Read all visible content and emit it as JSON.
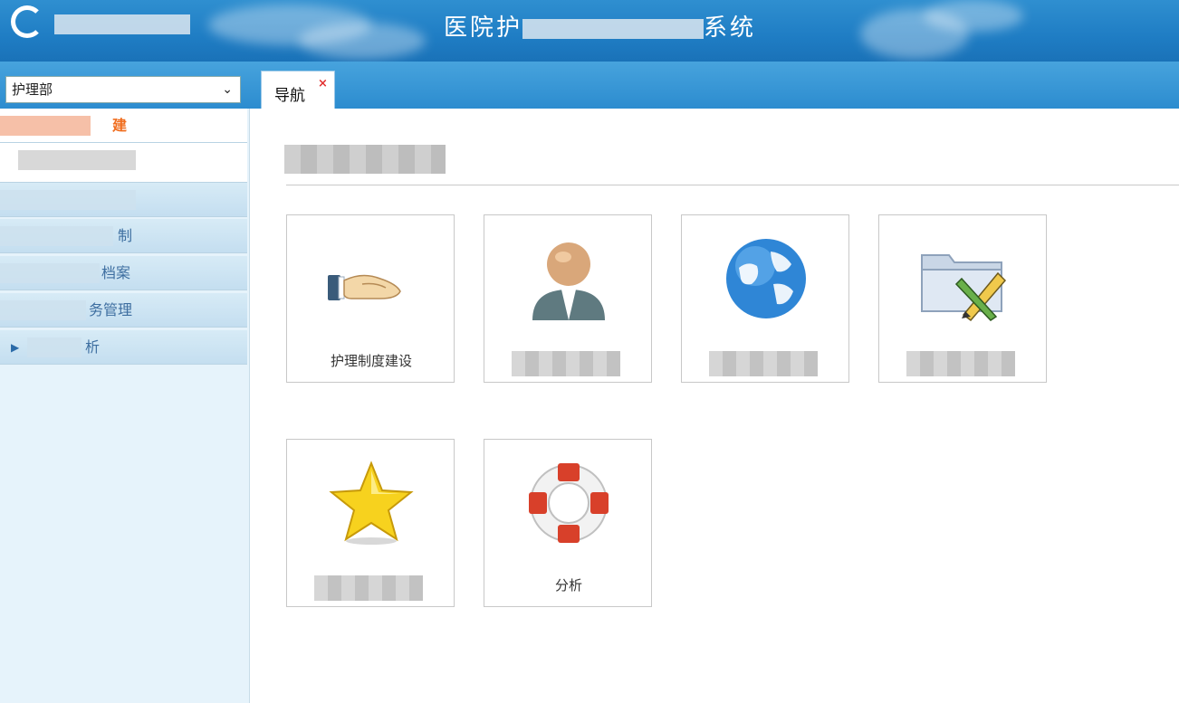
{
  "header": {
    "app_title": "医院护",
    "app_title_tail": "系统"
  },
  "toolbar": {
    "dept_select_value": "护理部"
  },
  "tabs": [
    {
      "label": "导航",
      "close_glyph": "×"
    }
  ],
  "sidebar": {
    "items": [
      {
        "label": "建",
        "state": "active"
      },
      {
        "label": "",
        "state": "sub"
      },
      {
        "label": "",
        "state": "normal"
      },
      {
        "label": "制",
        "state": "normal"
      },
      {
        "label": "档案",
        "state": "normal"
      },
      {
        "label": "务管理",
        "state": "normal"
      },
      {
        "label": "析",
        "state": "normal"
      }
    ]
  },
  "main": {
    "tiles": [
      {
        "label": "护理制度建设",
        "icon": "hand-icon"
      },
      {
        "label": "",
        "icon": "user-icon"
      },
      {
        "label": "",
        "icon": "globe-icon"
      },
      {
        "label": "",
        "icon": "folder-edit-icon"
      },
      {
        "label": "",
        "icon": "star-icon"
      },
      {
        "label": "分析",
        "icon": "lifebuoy-icon"
      }
    ]
  },
  "colors": {
    "header_blue": "#1f7dc4",
    "active_orange": "#f06d1e",
    "tab_close_red": "#e23030",
    "sidebar_bg": "#e6f3fb"
  }
}
